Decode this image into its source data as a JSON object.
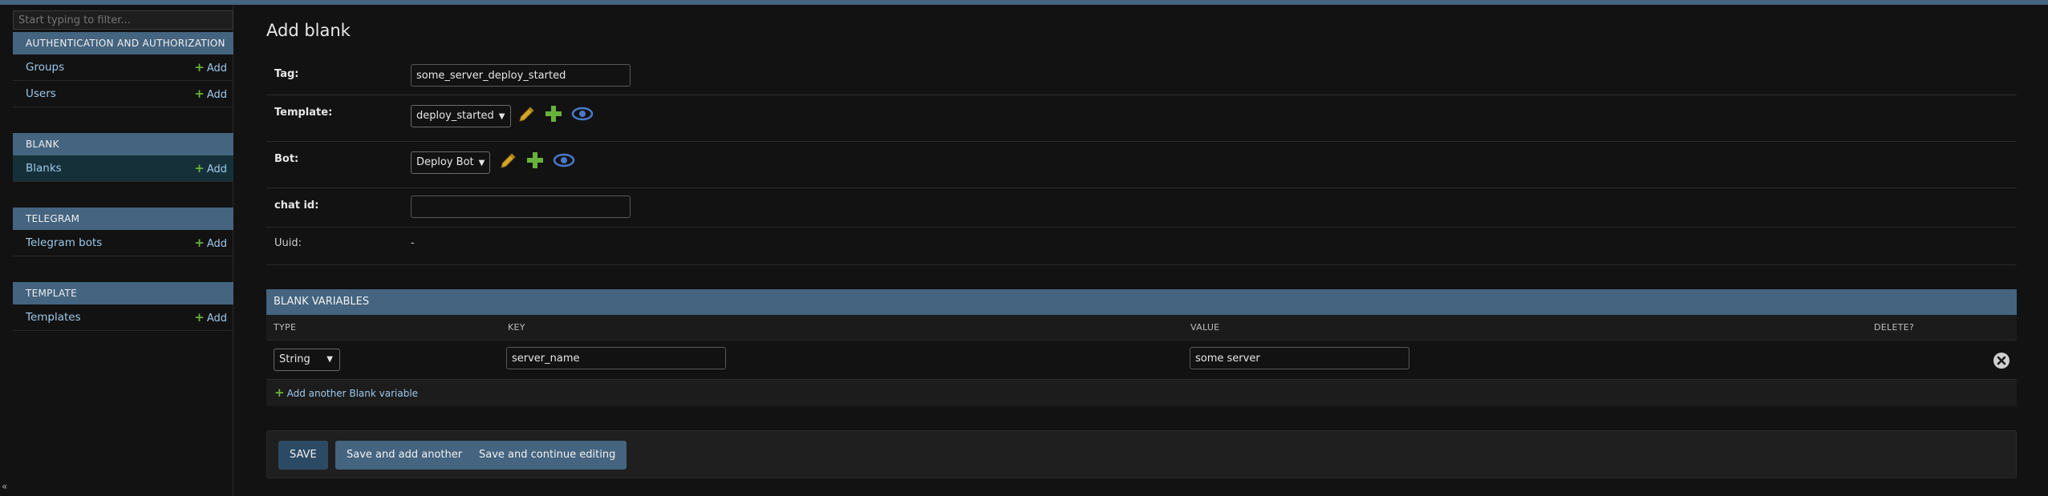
{
  "sidebar": {
    "filter_placeholder": "Start typing to filter...",
    "modules": [
      {
        "caption": "AUTHENTICATION AND AUTHORIZATION",
        "items": [
          {
            "label": "Groups",
            "add": "Add"
          },
          {
            "label": "Users",
            "add": "Add"
          }
        ]
      },
      {
        "caption": "BLANK",
        "items": [
          {
            "label": "Blanks",
            "add": "Add"
          }
        ]
      },
      {
        "caption": "TELEGRAM",
        "items": [
          {
            "label": "Telegram bots",
            "add": "Add"
          }
        ]
      },
      {
        "caption": "TEMPLATE",
        "items": [
          {
            "label": "Templates",
            "add": "Add"
          }
        ]
      }
    ],
    "corner_glyph": "«"
  },
  "page": {
    "title": "Add blank"
  },
  "form": {
    "tag": {
      "label": "Tag:",
      "value": "some_server_deploy_started"
    },
    "template": {
      "label": "Template:",
      "selected": "deploy_started"
    },
    "bot": {
      "label": "Bot:",
      "selected": "Deploy Bot"
    },
    "chat_id": {
      "label": "chat id:",
      "value": ""
    },
    "uuid": {
      "label": "Uuid:",
      "value": "-"
    }
  },
  "inline": {
    "caption": "BLANK VARIABLES",
    "headers": {
      "type": "TYPE",
      "key": "KEY",
      "value": "VALUE",
      "delete": "DELETE?"
    },
    "rows": [
      {
        "type": "String",
        "key": "server_name",
        "value": "some server"
      }
    ],
    "add_another": "Add another Blank variable"
  },
  "submit": {
    "save": "SAVE",
    "save_add_another": "Save and add another",
    "save_continue": "Save and continue editing"
  },
  "colors": {
    "header_blue": "#44647f",
    "link_blue": "#9dc9ec",
    "add_green": "#68b23b",
    "edit_yellow": "#d6a52a",
    "view_blue": "#4a79c9"
  }
}
